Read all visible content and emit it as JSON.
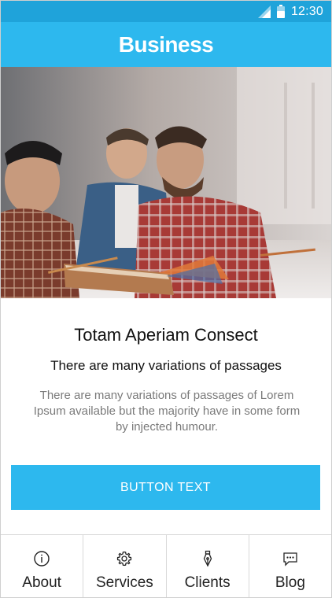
{
  "status_bar": {
    "time": "12:30",
    "icons": [
      "signal-icon",
      "battery-icon"
    ],
    "background_color": "#1fa3da"
  },
  "app_bar": {
    "title": "Business",
    "background_color": "#2db8ee"
  },
  "hero": {
    "description_icon": "photo-people-meeting"
  },
  "card": {
    "title": "Totam Aperiam Consect",
    "subtitle": "There are many variations of passages",
    "body": "There are many variations of passages of Lorem Ipsum available but the majority have in some form by injected humour."
  },
  "cta": {
    "label": "BUTTON TEXT",
    "color": "#2db8ee"
  },
  "bottom_nav": {
    "items": [
      {
        "label": "About",
        "icon": "info-icon"
      },
      {
        "label": "Services",
        "icon": "gear-icon"
      },
      {
        "label": "Clients",
        "icon": "pen-nib-icon"
      },
      {
        "label": "Blog",
        "icon": "chat-bubble-icon"
      }
    ]
  }
}
